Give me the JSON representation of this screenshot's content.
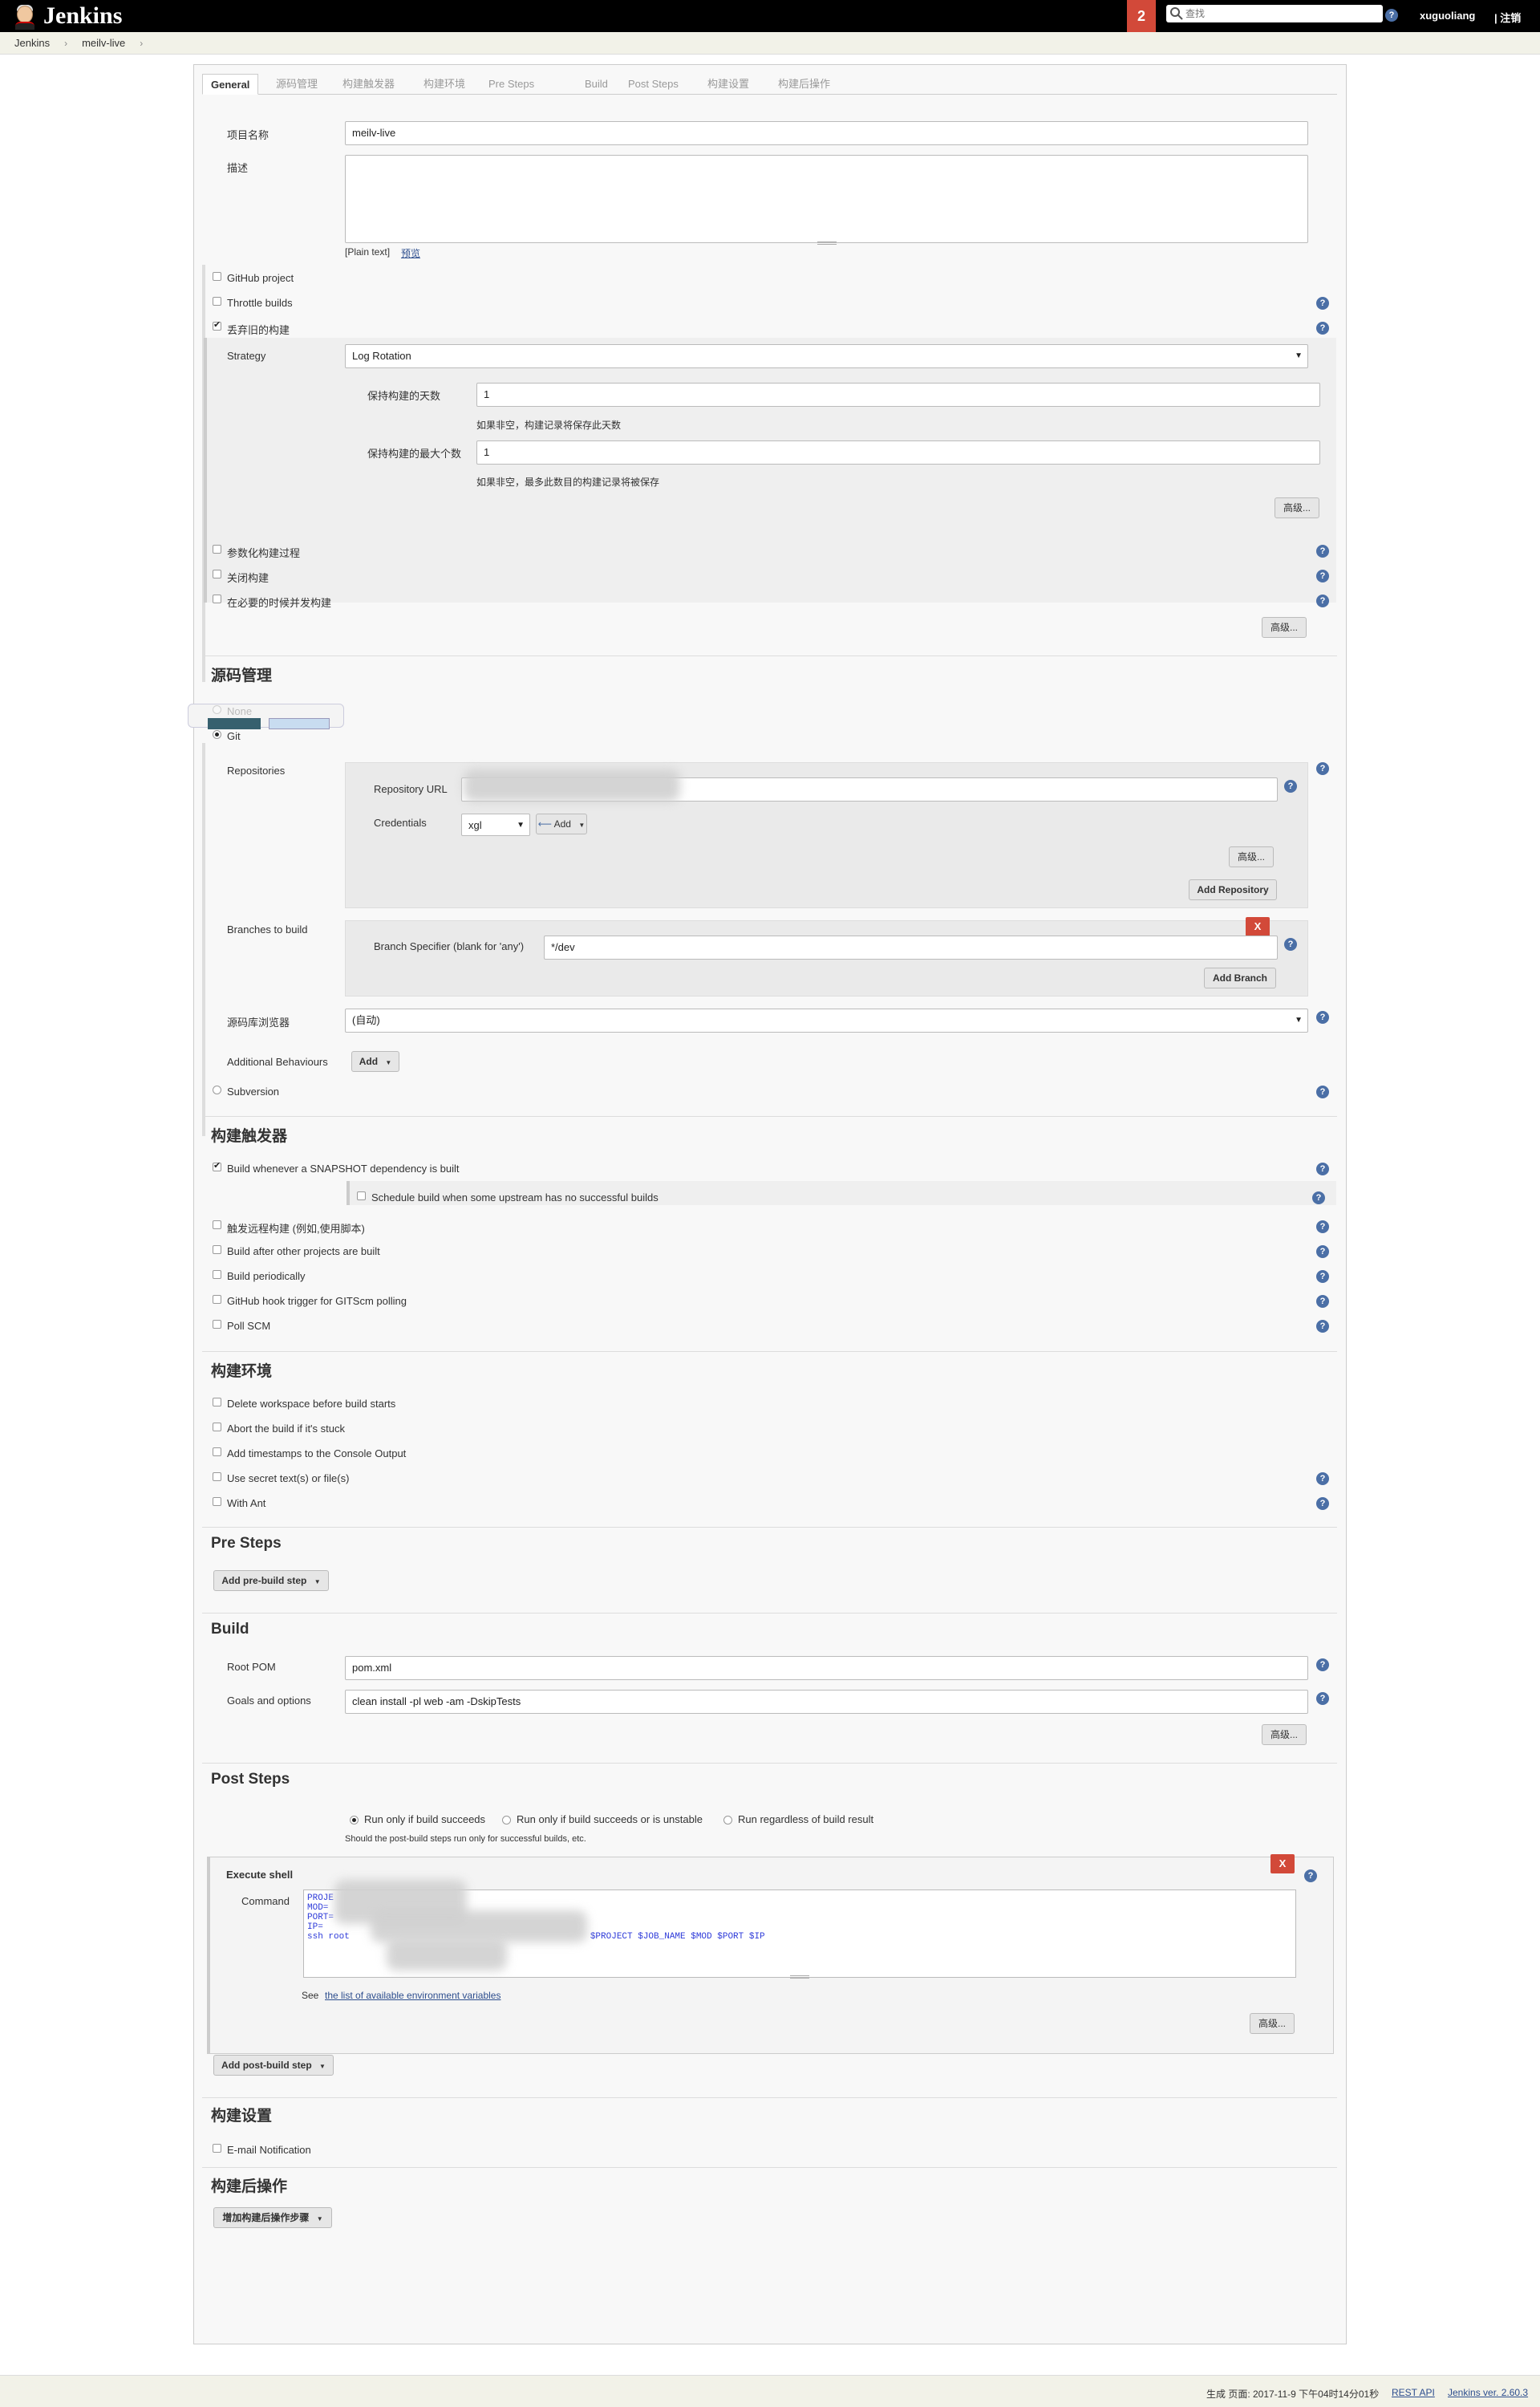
{
  "header": {
    "logo_text": "Jenkins",
    "notification_count": "2",
    "search_placeholder": "查找",
    "help_glyph": "?",
    "user": "xuguoliang",
    "logout": "| 注销"
  },
  "breadcrumb": {
    "items": [
      "Jenkins",
      "meilv-live"
    ],
    "separator": "›"
  },
  "tabs": [
    "General",
    "源码管理",
    "构建触发器",
    "构建环境",
    "Pre Steps",
    "Build",
    "Post Steps",
    "构建设置",
    "构建后操作"
  ],
  "general": {
    "project_name_label": "项目名称",
    "project_name_value": "meilv-live",
    "description_label": "描述",
    "plain_text": "[Plain text]",
    "preview_link": "预览",
    "github_project": "GitHub project",
    "throttle_builds": "Throttle builds",
    "discard_old": "丢弃旧的构建",
    "strategy_label": "Strategy",
    "strategy_value": "Log Rotation",
    "days_label": "保持构建的天数",
    "days_value": "1",
    "days_hint": "如果非空，构建记录将保存此天数",
    "max_label": "保持构建的最大个数",
    "max_value": "1",
    "max_hint": "如果非空，最多此数目的构建记录将被保存",
    "advanced": "高级...",
    "parameterized": "参数化构建过程",
    "disable_build": "关闭构建",
    "concurrent": "在必要的时候并发构建",
    "advanced2": "高级..."
  },
  "scm": {
    "title": "源码管理",
    "none_label": "None",
    "git_label": "Git",
    "repositories_label": "Repositories",
    "repo_url_label": "Repository URL",
    "credentials_label": "Credentials",
    "credentials_value": "xgl",
    "add_cred": "Add",
    "advanced": "高级...",
    "add_repository": "Add Repository",
    "branches_label": "Branches to build",
    "delete_glyph": "X",
    "branch_specifier_label": "Branch Specifier (blank for 'any')",
    "branch_specifier_value": "*/dev",
    "add_branch": "Add Branch",
    "browser_label": "源码库浏览器",
    "browser_value": "(自动)",
    "behaviours_label": "Additional Behaviours",
    "behaviours_add": "Add",
    "subversion_label": "Subversion"
  },
  "triggers": {
    "title": "构建触发器",
    "snapshot": "Build whenever a SNAPSHOT dependency is built",
    "schedule_upstream": "Schedule build when some upstream has no successful builds",
    "remote": "触发远程构建 (例如,使用脚本)",
    "after_other": "Build after other projects are built",
    "periodically": "Build periodically",
    "github_hook": "GitHub hook trigger for GITScm polling",
    "poll_scm": "Poll SCM"
  },
  "environment": {
    "title": "构建环境",
    "delete_workspace": "Delete workspace before build starts",
    "abort_stuck": "Abort the build if it's stuck",
    "timestamps": "Add timestamps to the Console Output",
    "secret": "Use secret text(s) or file(s)",
    "with_ant": "With Ant"
  },
  "presteps": {
    "title": "Pre Steps",
    "add_button": "Add pre-build step"
  },
  "build": {
    "title": "Build",
    "root_pom_label": "Root POM",
    "root_pom_value": "pom.xml",
    "goals_label": "Goals and options",
    "goals_value": "clean install -pl web -am -DskipTests",
    "advanced": "高级..."
  },
  "poststeps": {
    "title": "Post Steps",
    "radio1": "Run only if build succeeds",
    "radio2": "Run only if build succeeds or is unstable",
    "radio3": "Run regardless of build result",
    "radio_hint": "Should the post-build steps run only for successful builds, etc.",
    "execute_shell": "Execute shell",
    "delete_glyph": "X",
    "command_label": "Command",
    "code_lines": [
      "PROJE",
      "MOD=",
      "PORT=",
      "IP=",
      "ssh root"
    ],
    "code_tail": "$PROJECT $JOB_NAME $MOD $PORT $IP",
    "see_text": "See",
    "env_link": "the list of available environment variables",
    "advanced": "高级...",
    "add_button": "Add post-build step"
  },
  "settings": {
    "title": "构建设置",
    "email": "E-mail Notification"
  },
  "postbuild": {
    "title": "构建后操作",
    "add_button": "增加构建后操作步骤"
  },
  "footer": {
    "generated": "生成 页面: 2017-11-9 下午04时14分01秒",
    "rest_api": "REST API",
    "version": "Jenkins ver. 2.60.3"
  },
  "colors": {
    "header_bg": "#000000",
    "notification_bg": "#d24939",
    "help_icon": "#4b6fa6",
    "link": "#2d4e8e",
    "code_text": "#2e3bd9"
  }
}
